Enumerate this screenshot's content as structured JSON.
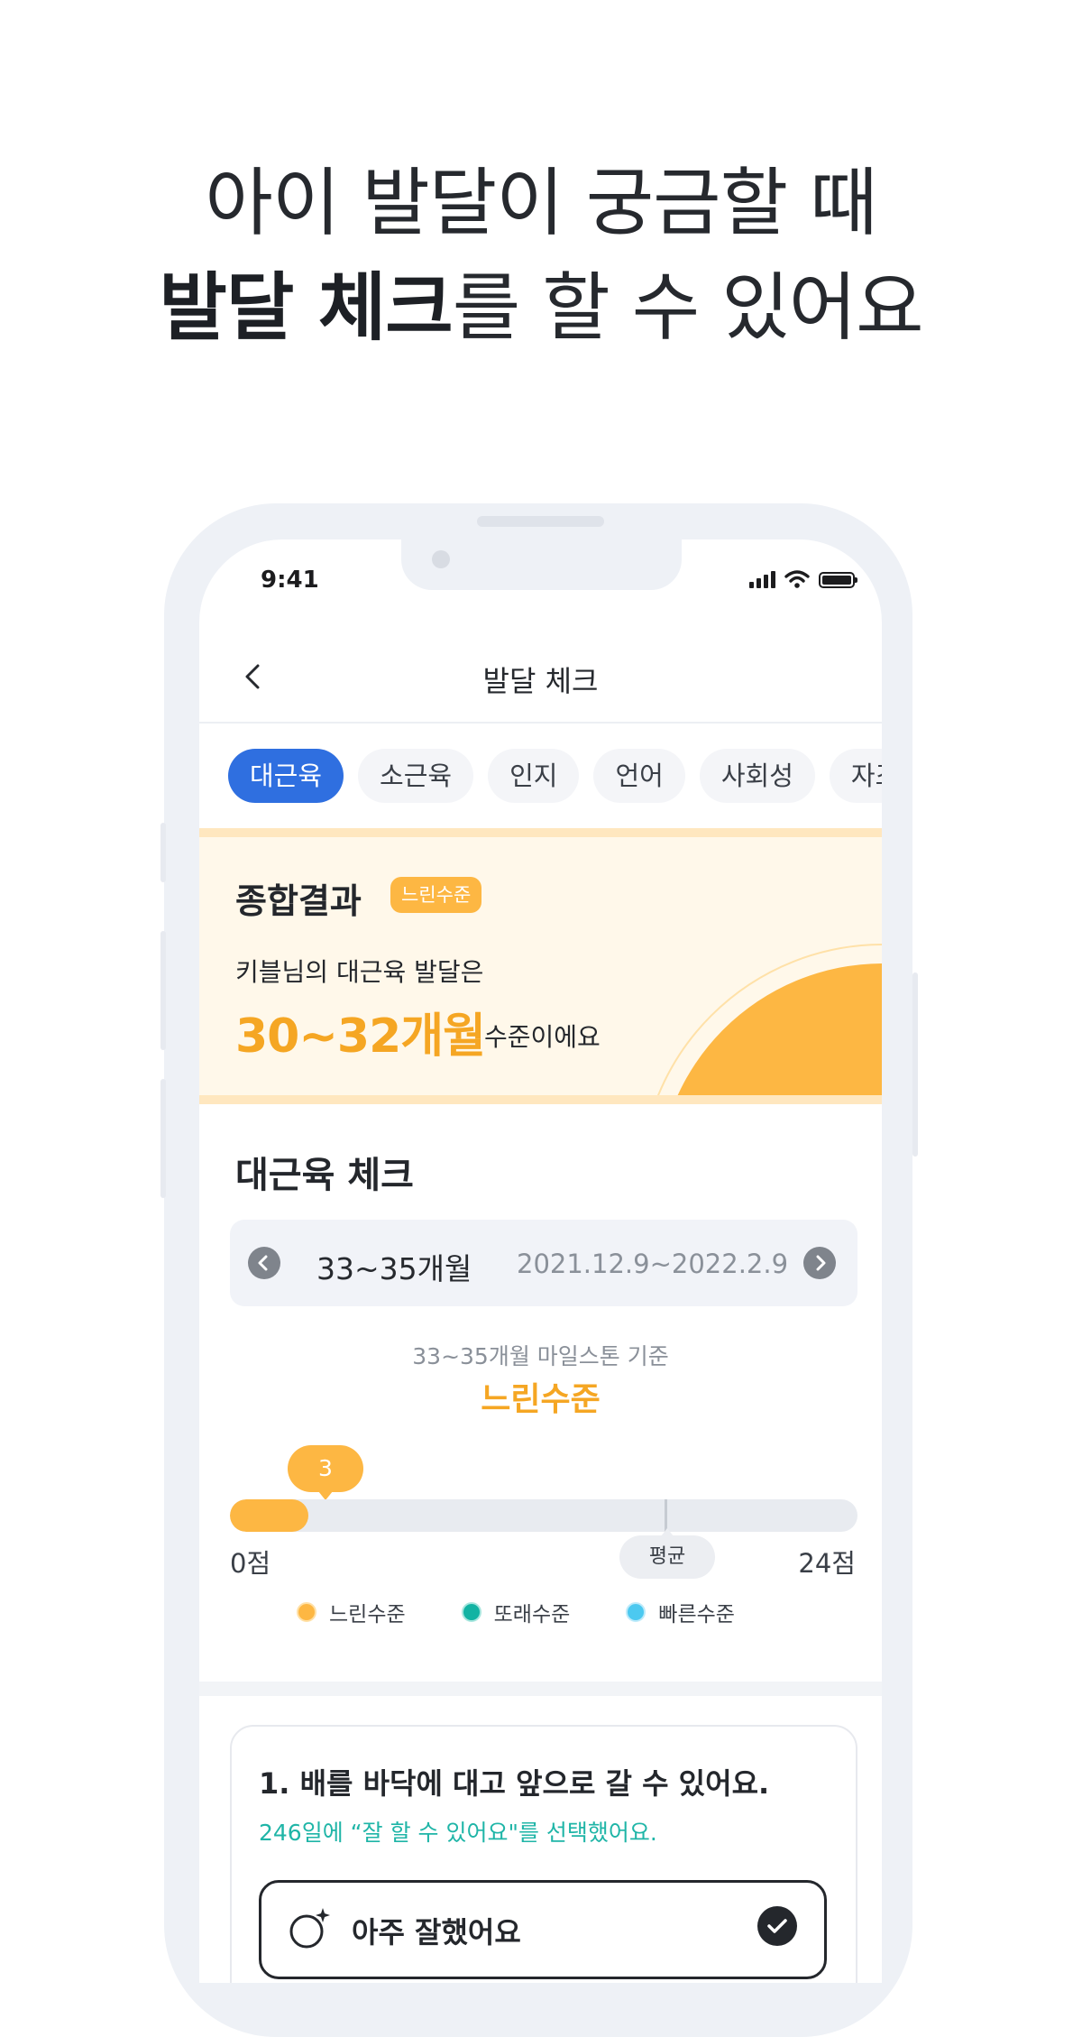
{
  "headline": {
    "line1": "아이 발달이 궁금할 때",
    "line2_bold": "발달 체크",
    "line2_rest": "를 할 수 있어요"
  },
  "status_bar": {
    "time": "9:41"
  },
  "nav": {
    "back_icon": "chevron-left-icon",
    "title": "발달 체크"
  },
  "tabs": [
    {
      "label": "대근육",
      "active": true
    },
    {
      "label": "소근육",
      "active": false
    },
    {
      "label": "인지",
      "active": false
    },
    {
      "label": "언어",
      "active": false
    },
    {
      "label": "사회성",
      "active": false
    },
    {
      "label": "자조",
      "active": false
    }
  ],
  "result": {
    "title": "종합결과",
    "badge": "느린수준",
    "description": "키블님의 대근육 발달은",
    "value": "30~32개월",
    "suffix": "수준이에요"
  },
  "check_section": {
    "title": "대근육 체크",
    "period": {
      "age": "33~35개월",
      "dates": "2021.12.9~2022.2.9"
    },
    "milestone_caption": "33~35개월 마일스톤 기준",
    "level": "느린수준",
    "score": {
      "value": "3",
      "min_label": "0점",
      "max_label": "24점",
      "fraction": 0.125,
      "average_label": "평균",
      "average_fraction": 0.7
    },
    "legend": [
      {
        "label": "느린수준",
        "color": "#fdb743"
      },
      {
        "label": "또래수준",
        "color": "#12b3a3"
      },
      {
        "label": "빠른수준",
        "color": "#4cc9f0"
      }
    ]
  },
  "question": {
    "title": "1. 배를 바닥에 대고 앞으로 갈 수 있어요.",
    "subtitle": "246일에 “잘 할 수 있어요\"를 선택했어요.",
    "answer_label": "아주 잘했어요"
  },
  "colors": {
    "accent_blue": "#2f6fe0",
    "accent_orange": "#fdb743",
    "teal": "#12b3a3"
  }
}
